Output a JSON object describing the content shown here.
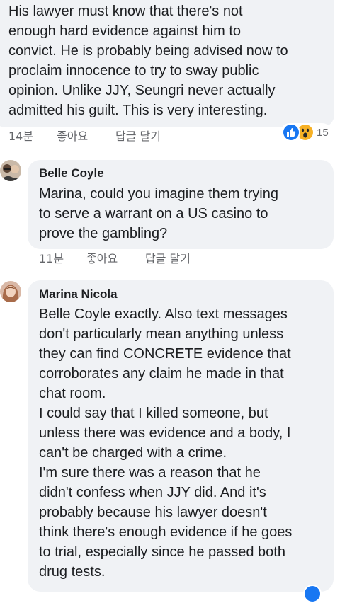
{
  "comments": [
    {
      "author": "",
      "text": "His lawyer must know that there's not\nenough hard evidence against him to\nconvict. He is probably being advised now to\nproclaim innocence to try to sway public\nopinion. Unlike JJY, Seungri never actually\nadmitted his guilt. This is very interesting.",
      "time": "14분",
      "like_label": "좋아요",
      "reply_label": "답글 달기",
      "reactions": {
        "icons": [
          "like-icon",
          "wow-icon"
        ],
        "count": "15",
        "colors": {
          "like": "#1877f2",
          "wow": "#f7b125"
        }
      }
    },
    {
      "author": "Belle Coyle",
      "text": "Marina, could you imagine them trying\nto serve a warrant on a US casino to\nprove the gambling?",
      "time": "11분",
      "like_label": "좋아요",
      "reply_label": "답글 달기"
    },
    {
      "author": "Marina Nicola",
      "text": "Belle Coyle exactly. Also text messages\ndon't particularly mean anything unless\nthey can find CONCRETE evidence that\ncorroborates any claim he made in that\nchat room.\nI could say that I killed someone, but\nunless there was evidence and a body, I\ncan't be charged with a crime.\nI'm sure there was a reason that he\ndidn't confess when JJY did. And it's\nprobably because his lawyer doesn't\nthink there's enough evidence if he goes\nto trial, especially since he passed both\ndrug tests."
    }
  ],
  "colors": {
    "bubble": "#f0f2f5",
    "meta_text": "#65676b",
    "body_text": "#1c1e21"
  }
}
